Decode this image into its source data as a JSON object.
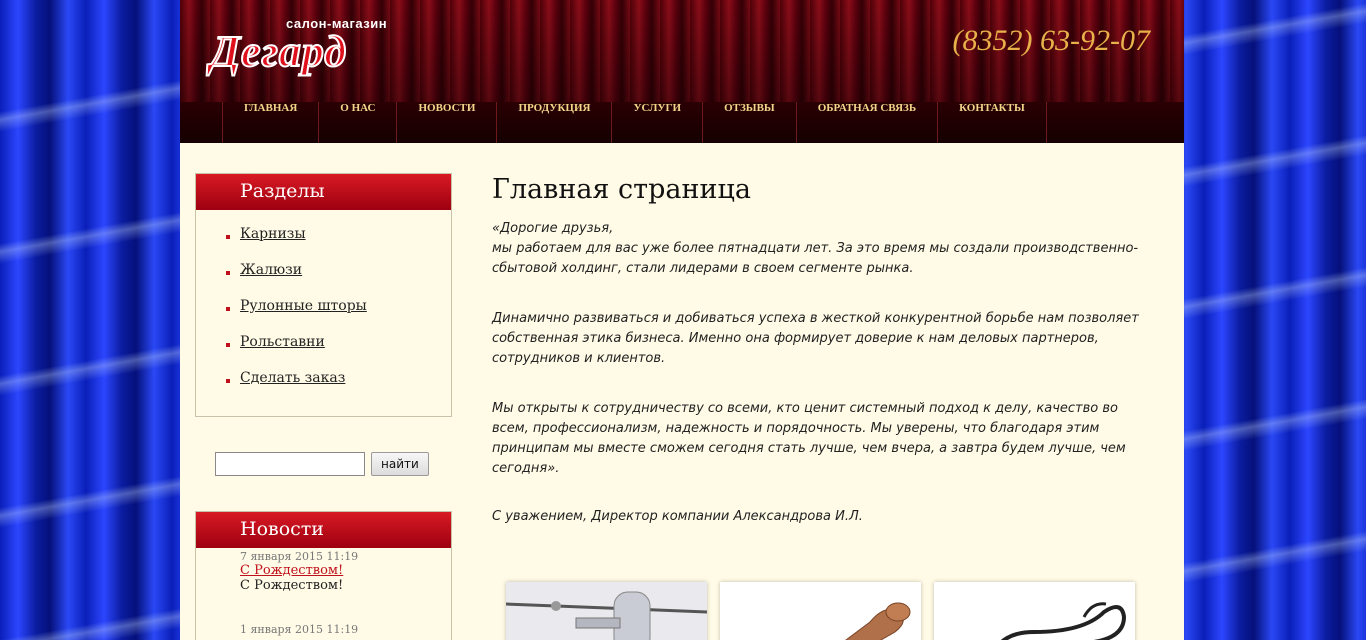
{
  "header": {
    "logo_small": "салон-магазин",
    "logo_big": "Дегард",
    "phone": "(8352) 63-92-07"
  },
  "nav": [
    {
      "label": "ГЛАВНАЯ"
    },
    {
      "label": "О НАС"
    },
    {
      "label": "НОВОСТИ"
    },
    {
      "label": "ПРОДУКЦИЯ"
    },
    {
      "label": "УСЛУГИ"
    },
    {
      "label": "ОТЗЫВЫ"
    },
    {
      "label": "ОБРАТНАЯ СВЯЗЬ"
    },
    {
      "label": "КОНТАКТЫ"
    }
  ],
  "sections": {
    "title": "Разделы",
    "items": [
      "Карнизы",
      "Жалюзи",
      "Рулонные шторы",
      "Рольставни",
      "Сделать заказ"
    ]
  },
  "search": {
    "value": "",
    "button": "найти"
  },
  "news": {
    "title": "Новости",
    "items": [
      {
        "date": "7 января 2015 11:19",
        "title": "С Рождеством!",
        "text": "С Рождеством!"
      },
      {
        "date": "1 января 2015 11:19",
        "title": "",
        "text": ""
      }
    ]
  },
  "main": {
    "title": "Главная страница",
    "paragraphs": [
      "«Дорогие друзья,\nмы работаем для вас уже более пятнадцати лет. За это время мы создали производственно-сбытовой холдинг, стали лидерами в своем сегменте рынка.",
      "Динамично развиваться и добиваться успеха в жесткой конкурентной борьбе нам позволяет собственная этика бизнеса. Именно она формирует доверие к нам деловых партнеров, сотрудников и клиентов.",
      "Мы открыты к сотрудничеству со всеми, кто ценит системный подход к делу, качество во всем, профессионализм, надежность и порядочность. Мы уверены, что благодаря этим принципам мы вместе сможем сегодня стать лучше, чем вчера, а завтра будем лучше, чем сегодня»."
    ],
    "signature": "С уважением,  Директор компании Александрова И.Л."
  },
  "colors": {
    "accent": "#c0101c",
    "phone": "#e8b24a",
    "nav_text": "#f3d58a",
    "page_bg": "#fffbe6"
  }
}
